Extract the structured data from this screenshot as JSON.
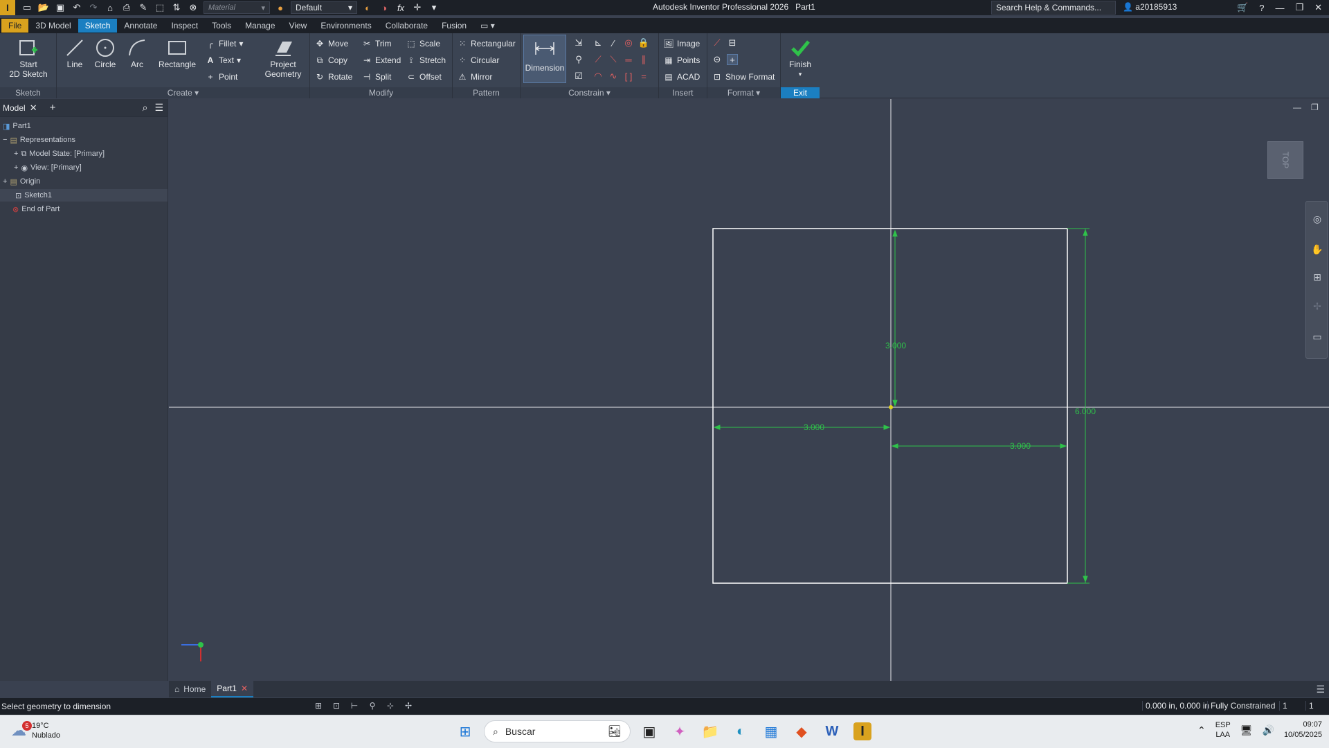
{
  "title_bar": {
    "app_title": "Autodesk Inventor Professional 2026",
    "doc_name": "Part1",
    "material_placeholder": "Material",
    "appearance": "Default",
    "search_placeholder": "Search Help & Commands...",
    "username": "a20185913"
  },
  "ribbon_tabs": [
    "File",
    "3D Model",
    "Sketch",
    "Annotate",
    "Inspect",
    "Tools",
    "Manage",
    "View",
    "Environments",
    "Collaborate",
    "Fusion"
  ],
  "ribbon": {
    "sketch_panel": {
      "title": "Sketch",
      "start_label_1": "Start",
      "start_label_2": "2D Sketch"
    },
    "create_panel": {
      "title": "Create",
      "line": "Line",
      "circle": "Circle",
      "arc": "Arc",
      "rectangle": "Rectangle",
      "fillet": "Fillet",
      "text": "Text",
      "point": "Point",
      "project_1": "Project",
      "project_2": "Geometry"
    },
    "modify_panel": {
      "title": "Modify",
      "move": "Move",
      "trim": "Trim",
      "scale": "Scale",
      "copy": "Copy",
      "extend": "Extend",
      "stretch": "Stretch",
      "rotate": "Rotate",
      "split": "Split",
      "offset": "Offset"
    },
    "pattern_panel": {
      "title": "Pattern",
      "rectangular": "Rectangular",
      "circular": "Circular",
      "mirror": "Mirror"
    },
    "constrain_panel": {
      "title": "Constrain",
      "dimension": "Dimension"
    },
    "insert_panel": {
      "title": "Insert",
      "image": "Image",
      "points": "Points",
      "acad": "ACAD"
    },
    "format_panel": {
      "title": "Format",
      "show_format": "Show Format"
    },
    "exit_panel": {
      "title": "Exit",
      "finish": "Finish"
    }
  },
  "browser": {
    "tab_label": "Model",
    "items": [
      {
        "label": "Part1"
      },
      {
        "label": "Representations"
      },
      {
        "label": "Model State: [Primary]"
      },
      {
        "label": "View: [Primary]"
      },
      {
        "label": "Origin"
      },
      {
        "label": "Sketch1"
      },
      {
        "label": "End of Part"
      }
    ]
  },
  "sketch": {
    "dim_vertical_center": "3.000",
    "dim_vertical_overall": "6.000",
    "dim_horizontal_left": "3.000",
    "dim_horizontal_right": "3.000",
    "colors": {
      "dimension": "#2fc24a",
      "geometry": "#ffffff",
      "axes": "#e6e8eb",
      "center_point": "#e0d21e"
    }
  },
  "viewcube": {
    "face": "TOP"
  },
  "doc_tabs": {
    "home": "Home",
    "part": "Part1"
  },
  "status_bar": {
    "message": "Select geometry to dimension",
    "coords": "0.000 in, 0.000 in",
    "constraint_state": "Fully Constrained",
    "count_1": "1",
    "count_2": "1"
  },
  "taskbar": {
    "weather_temp": "19°C",
    "weather_desc": "Nublado",
    "notif_count": "5",
    "search_placeholder": "Buscar",
    "lang_1": "ESP",
    "lang_2": "LAA",
    "time": "09:07",
    "date": "10/05/2025"
  }
}
